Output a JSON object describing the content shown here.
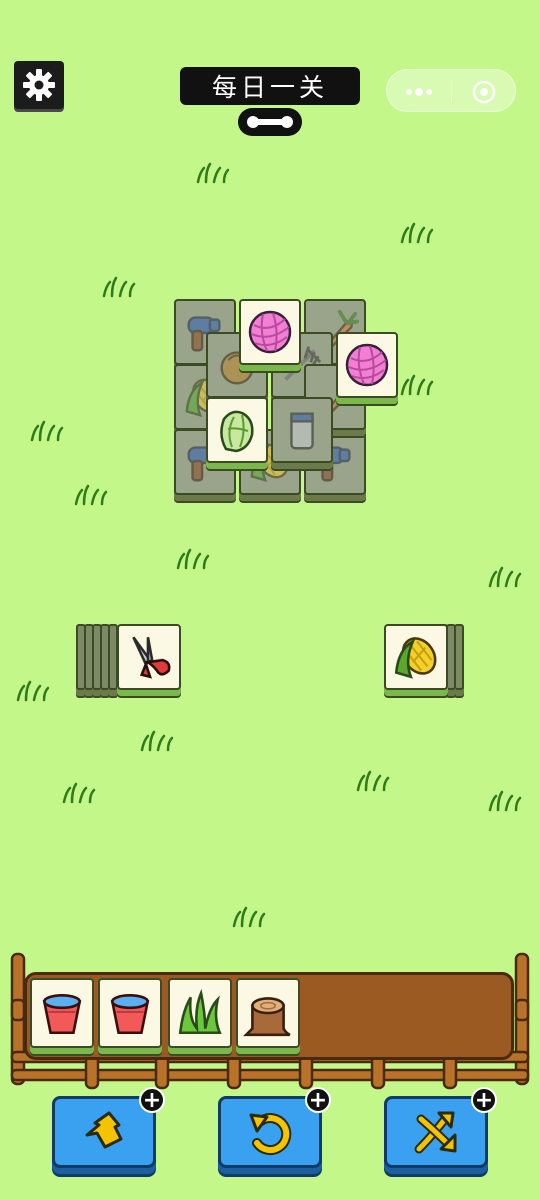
{
  "header": {
    "title": "每日一关",
    "settings_icon": "gear-icon",
    "menu_icon": "more-dots-icon",
    "close_icon": "target-circle-icon"
  },
  "board_tiles": [
    {
      "item": "hair-dryer",
      "layer": "under"
    },
    {
      "item": "yarn-ball",
      "layer": "top"
    },
    {
      "item": "carrot",
      "layer": "under"
    },
    {
      "item": "coconut",
      "layer": "under"
    },
    {
      "item": "yarn-ball",
      "layer": "top"
    },
    {
      "item": "corn",
      "layer": "under"
    },
    {
      "item": "rake",
      "layer": "under"
    },
    {
      "item": "carrot",
      "layer": "under"
    },
    {
      "item": "napa-cabbage",
      "layer": "top"
    },
    {
      "item": "paint-can",
      "layer": "under"
    },
    {
      "item": "hair-dryer",
      "layer": "under"
    },
    {
      "item": "corn",
      "layer": "under"
    },
    {
      "item": "hair-dryer",
      "layer": "under"
    }
  ],
  "side_stacks": {
    "left": {
      "top_item": "pruning-shears"
    },
    "right": {
      "top_item": "corn"
    }
  },
  "tray": {
    "capacity": 7,
    "items": [
      "water-bucket",
      "water-bucket",
      "grass-clump",
      "tree-stump"
    ]
  },
  "tools": [
    {
      "name": "undo-out",
      "icon": "pop-up-arrow-icon",
      "badge": "+"
    },
    {
      "name": "undo",
      "icon": "undo-arrow-icon",
      "badge": "+"
    },
    {
      "name": "shuffle",
      "icon": "shuffle-arrows-icon",
      "badge": "+"
    }
  ],
  "colors": {
    "background": "#c3f78a",
    "tile_face": "#fbf8e4",
    "tray_wood": "#9a5a22",
    "tool_button": "#3aa0f0"
  }
}
